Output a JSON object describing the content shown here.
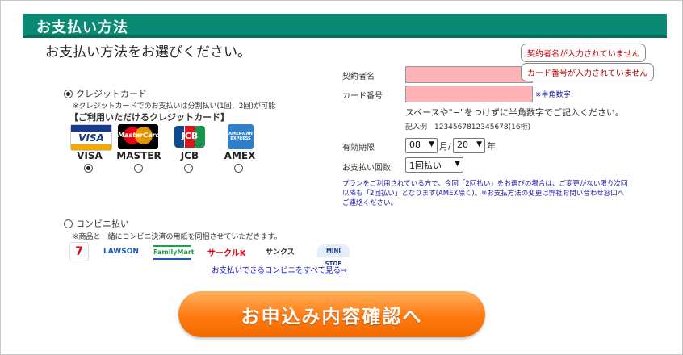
{
  "header": {
    "title": "お支払い方法"
  },
  "subtitle": "お支払い方法をお選びください。",
  "credit": {
    "option_label": "クレジットカード",
    "note": "※クレジットカードでのお支払いは分割払い(1回、2回)が可能",
    "heading": "【ご利用いただけるクレジットカード】",
    "cards": [
      {
        "name": "VISA",
        "logo": "VISA",
        "selected": true
      },
      {
        "name": "MASTER",
        "logo": "MasterCard",
        "selected": false
      },
      {
        "name": "JCB",
        "logo": "JCB",
        "selected": false
      },
      {
        "name": "AMEX",
        "logo": "AMERICAN EXPRESS",
        "selected": false
      }
    ]
  },
  "form": {
    "holder_label": "契約者名",
    "card_number_label": "カード番号",
    "card_number_hint": "※半角数字",
    "instruction": "スペースや\"−\"をつけずに半角数字でご記入ください。",
    "example": "記入例　1234567812345678(16桁)",
    "expiry_label": "有効期限",
    "expiry_month": "08",
    "expiry_month_unit": "月/",
    "expiry_year": "20",
    "expiry_year_unit": "年",
    "installments_label": "お支払い回数",
    "installments_value": "1回払い",
    "plan_note": "プランをご利用されている方で、今回「2回払い」をお選びの場合は、ご変更がない限り次回以降も「2回払い」となります(AMEX除く)。※お支払方法の変更は弊社お問い合わせ窓口へご連絡ください。"
  },
  "errors": {
    "holder": "契約者名が入力されていません",
    "card_number": "カード番号が入力されていません"
  },
  "convenience": {
    "option_label": "コンビニ払い",
    "note": "※商品と一緒にコンビニ決済の用紙を同梱させていただきます。",
    "stores": [
      "7",
      "LAWSON",
      "FamilyMart",
      "サークルK",
      "サンクス",
      "MINI STOP"
    ],
    "link": "お支払いできるコンビニをすべて見る→"
  },
  "submit": {
    "label": "お申込み内容確認へ"
  },
  "colors": {
    "header": "#0a8a74",
    "error_field": "#ffb3b6",
    "submit": "#ff7a10",
    "note_blue": "#1a1aa6"
  }
}
